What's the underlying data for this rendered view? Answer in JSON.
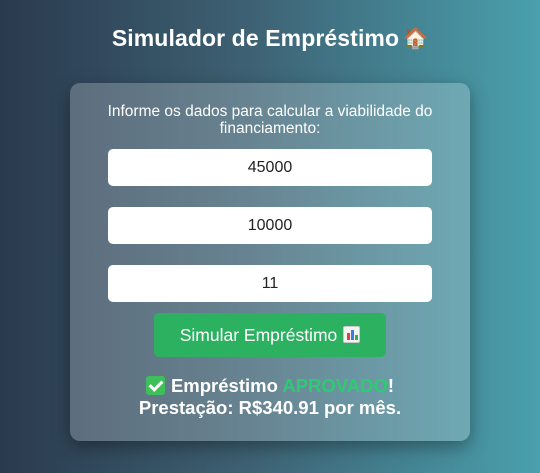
{
  "header": {
    "title": "Simulador de Empréstimo",
    "title_icon": "🏠"
  },
  "form": {
    "intro": "Informe os dados para calcular a viabilidade do financiamento:",
    "fields": [
      {
        "value": "45000"
      },
      {
        "value": "10000"
      },
      {
        "value": "11"
      }
    ],
    "submit_label": "Simular Empréstimo"
  },
  "result": {
    "prefix": "Empréstimo",
    "status": "APROVADO",
    "exclaim": "!",
    "installment_line": "Prestação: R$340.91 por mês."
  },
  "colors": {
    "accent": "#2bb15f",
    "approved": "#2ecc71"
  }
}
